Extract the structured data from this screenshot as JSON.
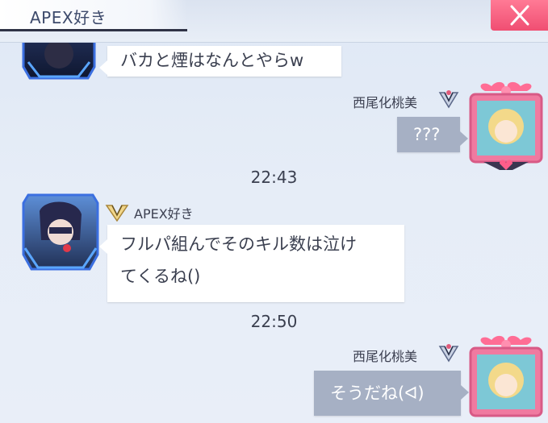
{
  "header": {
    "title": "APEX好き"
  },
  "messages": [
    {
      "sender": "APEX好き",
      "side": "left",
      "text_lines": [
        "バカと煙はなんとやらw"
      ]
    },
    {
      "sender": "西尾化桃美",
      "side": "right",
      "text_lines": [
        "???"
      ]
    },
    {
      "time": "22:43"
    },
    {
      "sender": "APEX好き",
      "side": "left",
      "text_lines": [
        "フルパ組んでそのキル数は泣け",
        "てくるね()"
      ]
    },
    {
      "time": "22:50"
    },
    {
      "sender": "西尾化桃美",
      "side": "right",
      "text_lines": [
        "そうだね(ᐊ)"
      ]
    }
  ],
  "colors": {
    "close_button": "#f04e72",
    "outgoing_bubble": "#a6b0c4",
    "incoming_bubble": "#ffffff"
  }
}
